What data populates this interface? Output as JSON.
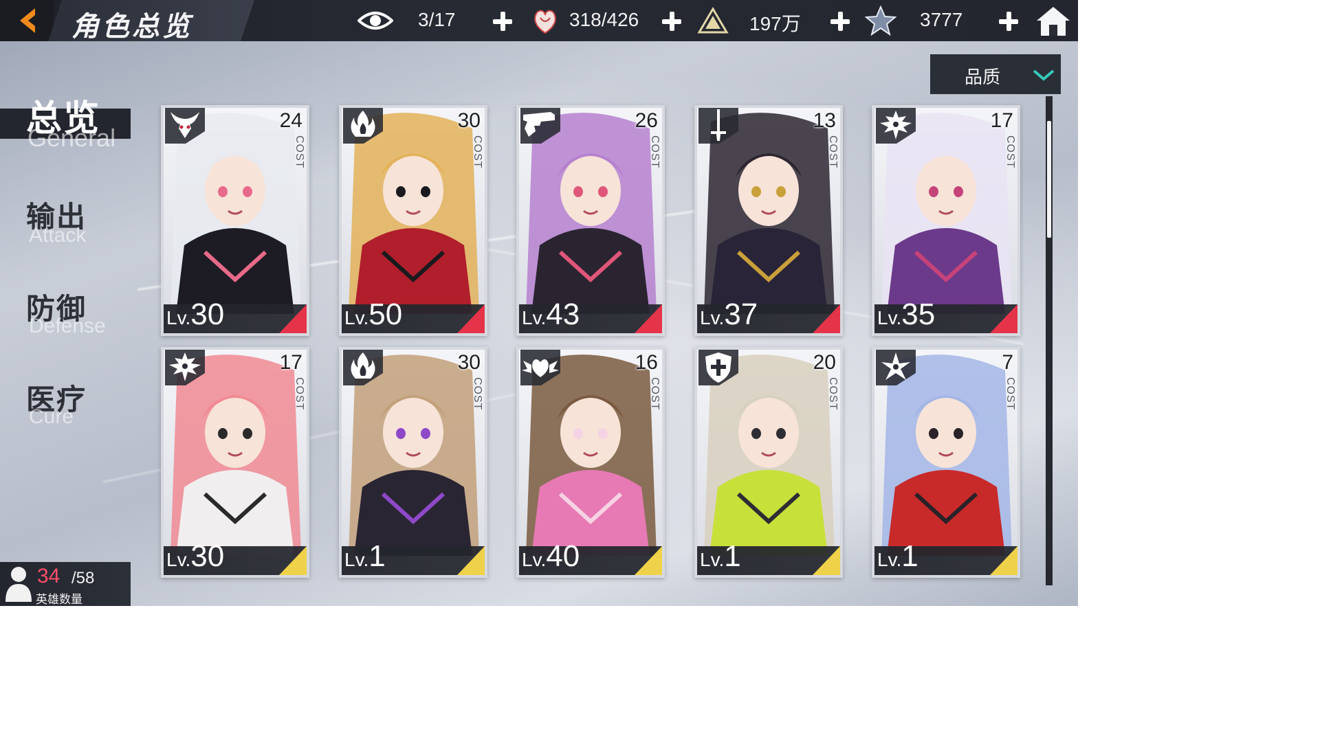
{
  "header": {
    "title": "角色总览",
    "resources": [
      {
        "icon": "eye-icon",
        "value": "3/17"
      },
      {
        "icon": "stamina-heart-icon",
        "value": "318/426"
      },
      {
        "icon": "gold-triangle-icon",
        "value": "197万"
      },
      {
        "icon": "star-crystal-icon",
        "value": "3777"
      }
    ]
  },
  "sort": {
    "label": "品质"
  },
  "sidebar": {
    "items": [
      {
        "zh": "总览",
        "en": "General",
        "active": true
      },
      {
        "zh": "输出",
        "en": "Attack",
        "active": false
      },
      {
        "zh": "防御",
        "en": "Defense",
        "active": false
      },
      {
        "zh": "医疗",
        "en": "Cure",
        "active": false
      }
    ]
  },
  "cards": [
    {
      "cost": "24",
      "lv": "30",
      "class_icon": "demon-horns-icon",
      "corner": "#e5344a",
      "hair": "#e8eaef",
      "outfit": "#1d1c24",
      "accent": "#e86a8a"
    },
    {
      "cost": "30",
      "lv": "50",
      "class_icon": "flame-icon",
      "corner": "#e5344a",
      "hair": "#e3b25a",
      "outfit": "#b11e2c",
      "accent": "#1a1a1f"
    },
    {
      "cost": "26",
      "lv": "43",
      "class_icon": "revolver-icon",
      "corner": "#e5344a",
      "hair": "#b680cf",
      "outfit": "#2a2430",
      "accent": "#e0567a"
    },
    {
      "cost": "13",
      "lv": "37",
      "class_icon": "sword-icon",
      "corner": "#e5344a",
      "hair": "#2d2630",
      "outfit": "#2a2438",
      "accent": "#c9a03a"
    },
    {
      "cost": "17",
      "lv": "35",
      "class_icon": "winged-cross-icon",
      "corner": "#e5344a",
      "hair": "#e9e3f3",
      "outfit": "#6b3a8a",
      "accent": "#c6437a"
    },
    {
      "cost": "17",
      "lv": "30",
      "class_icon": "winged-cross-icon",
      "corner": "#f0d24a",
      "hair": "#f08a93",
      "outfit": "#f1eef0",
      "accent": "#2a2a2a"
    },
    {
      "cost": "30",
      "lv": "1",
      "class_icon": "flame-icon",
      "corner": "#f0d24a",
      "hair": "#c2a07a",
      "outfit": "#2a2533",
      "accent": "#8e49c8"
    },
    {
      "cost": "16",
      "lv": "40",
      "class_icon": "winged-heart-icon",
      "corner": "#f0d24a",
      "hair": "#7a5a40",
      "outfit": "#e77ab4",
      "accent": "#f6d3e4"
    },
    {
      "cost": "20",
      "lv": "1",
      "class_icon": "cross-shield-icon",
      "corner": "#f0d24a",
      "hair": "#d8d0be",
      "outfit": "#c8e03a",
      "accent": "#2d2d33"
    },
    {
      "cost": "7",
      "lv": "1",
      "class_icon": "shuriken-icon",
      "corner": "#f0d24a",
      "hair": "#a3b6e6",
      "outfit": "#c82a2a",
      "accent": "#2a2228"
    }
  ],
  "card_labels": {
    "lv_prefix": "Lv.",
    "cost": "COST"
  },
  "hero_count": {
    "current": "34",
    "total": "/58",
    "label": "英雄数量"
  }
}
